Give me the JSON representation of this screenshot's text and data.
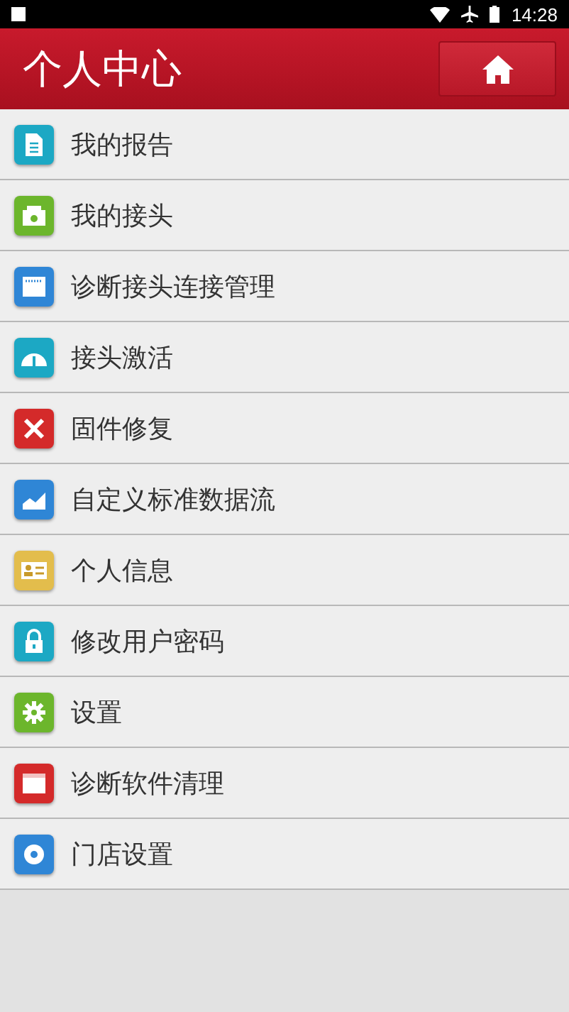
{
  "status_bar": {
    "time": "14:28"
  },
  "header": {
    "title": "个人中心"
  },
  "menu": [
    {
      "label": "我的报告",
      "kind": "report",
      "color": "#1ca8c4"
    },
    {
      "label": "我的接头",
      "kind": "connector",
      "color": "#6cb62c"
    },
    {
      "label": "诊断接头连接管理",
      "kind": "card",
      "color": "#2f86d6"
    },
    {
      "label": "接头激活",
      "kind": "gauge",
      "color": "#1ca8c4"
    },
    {
      "label": "固件修复",
      "kind": "tools",
      "color": "#d42a2a"
    },
    {
      "label": "自定义标准数据流",
      "kind": "chart",
      "color": "#2f86d6"
    },
    {
      "label": "个人信息",
      "kind": "idcard",
      "color": "#e3bd4c"
    },
    {
      "label": "修改用户密码",
      "kind": "lock",
      "color": "#1ca8c4"
    },
    {
      "label": "设置",
      "kind": "gear",
      "color": "#6cb62c"
    },
    {
      "label": "诊断软件清理",
      "kind": "window",
      "color": "#d42a2a"
    },
    {
      "label": "门店设置",
      "kind": "flower",
      "color": "#2f86d6"
    }
  ]
}
